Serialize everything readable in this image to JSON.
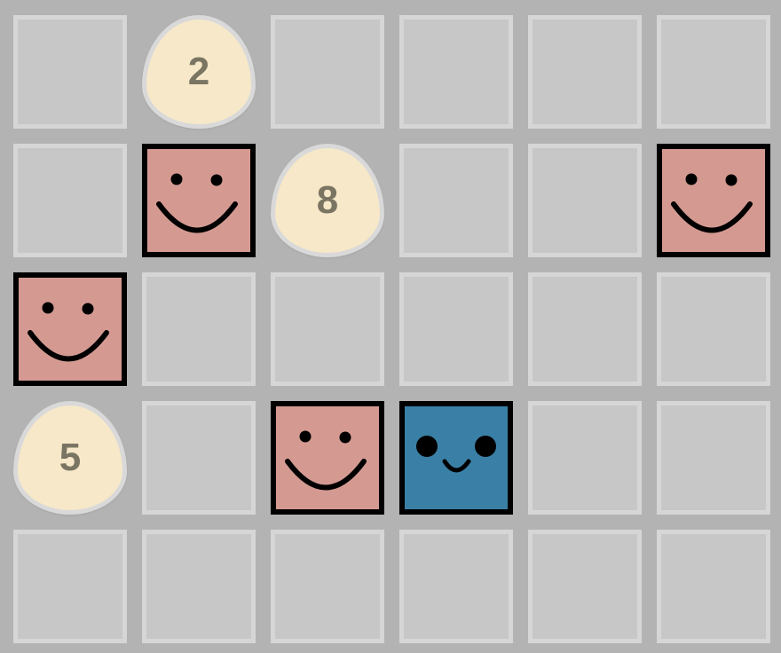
{
  "board": {
    "rows": 5,
    "cols": 6,
    "background_color": "#b3b3b3",
    "empty_cell_color": "#c7c7c7",
    "pieces": [
      {
        "type": "egg",
        "row": 0,
        "col": 1,
        "value": "2"
      },
      {
        "type": "face",
        "style": "smile",
        "row": 1,
        "col": 1
      },
      {
        "type": "egg",
        "row": 1,
        "col": 2,
        "value": "8"
      },
      {
        "type": "face",
        "style": "smile",
        "row": 1,
        "col": 5
      },
      {
        "type": "face",
        "style": "smile",
        "row": 2,
        "col": 0
      },
      {
        "type": "egg",
        "row": 3,
        "col": 0,
        "value": "5"
      },
      {
        "type": "face",
        "style": "smile",
        "row": 3,
        "col": 2
      },
      {
        "type": "face",
        "style": "player",
        "row": 3,
        "col": 3
      }
    ]
  },
  "colors": {
    "smile_face": "#d49a92",
    "player_face": "#3a80a6",
    "egg": "#f6e8c8"
  }
}
